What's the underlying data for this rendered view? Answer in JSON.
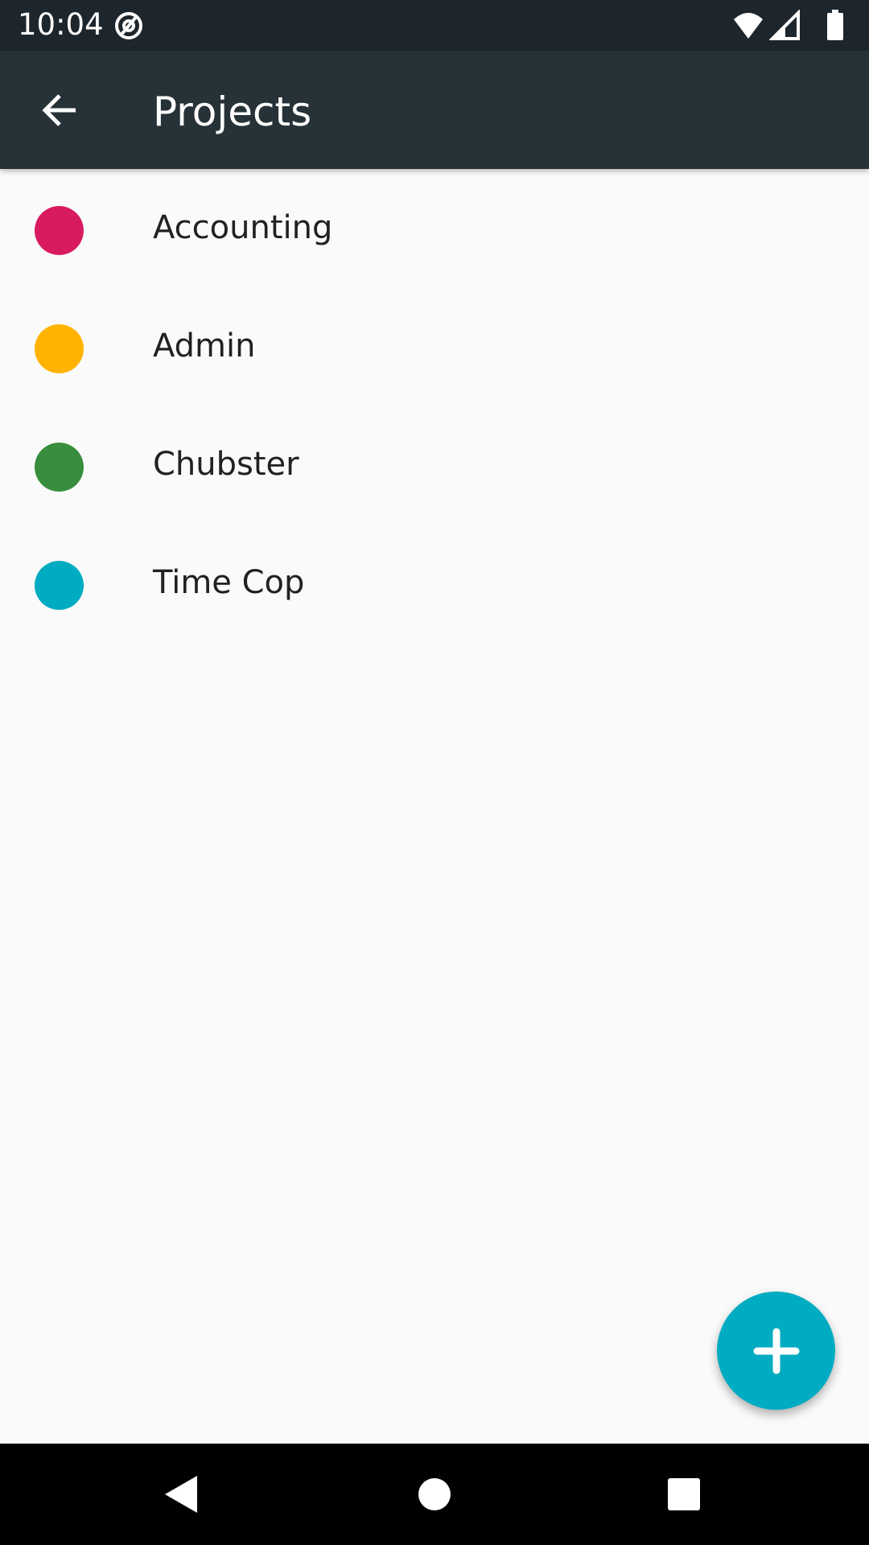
{
  "status_bar": {
    "time": "10:04",
    "icons": [
      "at-sign-icon",
      "wifi-icon",
      "signal-icon",
      "battery-icon"
    ]
  },
  "app_bar": {
    "title": "Projects",
    "back_icon": "arrow-left-icon"
  },
  "projects": [
    {
      "label": "Accounting",
      "color": "#d81b60"
    },
    {
      "label": "Admin",
      "color": "#ffb300"
    },
    {
      "label": "Chubster",
      "color": "#388e3c"
    },
    {
      "label": "Time Cop",
      "color": "#00acc1"
    }
  ],
  "fab": {
    "icon": "plus-icon",
    "color": "#00acc1"
  },
  "nav_bar": {
    "icons": [
      "back-triangle-icon",
      "home-circle-icon",
      "recents-square-icon"
    ]
  }
}
